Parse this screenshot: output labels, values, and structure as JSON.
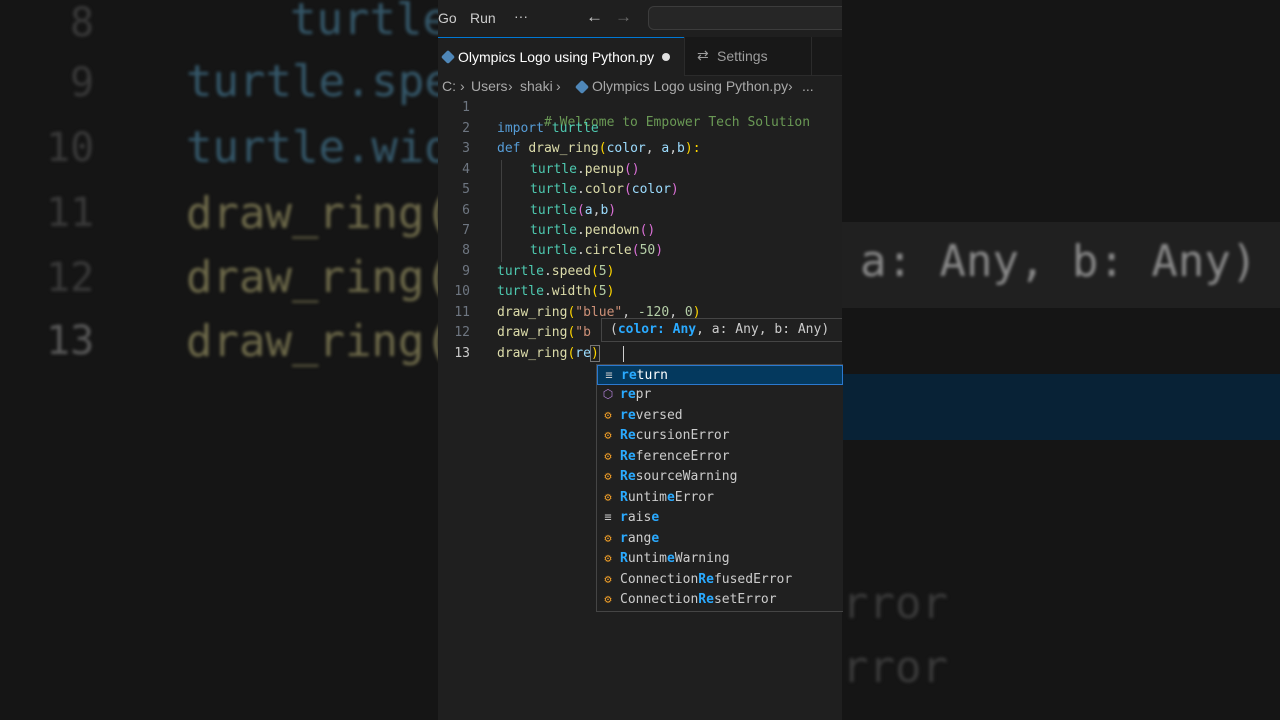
{
  "menu": {
    "go": "Go",
    "run": "Run",
    "more": "···",
    "back": "←",
    "forward": "→"
  },
  "tabs": {
    "active": "Olympics Logo using Python.py",
    "settings": "Settings",
    "settings_icon": "⇄"
  },
  "breadcrumb": {
    "drive": "C:",
    "sep": "›",
    "users": "Users",
    "user": "shaki",
    "file": "Olympics Logo using Python.py",
    "more": "..."
  },
  "line_numbers": [
    "1",
    "2",
    "3",
    "4",
    "5",
    "6",
    "7",
    "8",
    "9",
    "10",
    "11",
    "12",
    "13"
  ],
  "code": {
    "l1": "# Welcome to Empower Tech Solution",
    "l2a": "import",
    "l2b": "turtle",
    "l3a": "def",
    "l3b": "draw_ring",
    "l3c": "(",
    "l3d": "color",
    "l3e": ", ",
    "l3f": "a",
    "l3g": ",",
    "l3h": "b",
    "l3i": "):",
    "l4a": "turtle",
    "l4b": ".",
    "l4c": "penup",
    "l4d": "()",
    "l5a": "turtle",
    "l5b": ".",
    "l5c": "color",
    "l5d": "(",
    "l5e": "color",
    "l5f": ")",
    "l6a": "turtle",
    "l6b": "(",
    "l6c": "a",
    "l6d": ",",
    "l6e": "b",
    "l6f": ")",
    "l7a": "turtle",
    "l7b": ".",
    "l7c": "pendown",
    "l7d": "()",
    "l8a": "turtle",
    "l8b": ".",
    "l8c": "circle",
    "l8d": "(",
    "l8e": "50",
    "l8f": ")",
    "l9a": "turtle",
    "l9b": ".",
    "l9c": "speed",
    "l9d": "(",
    "l9e": "5",
    "l9f": ")",
    "l10a": "turtle",
    "l10b": ".",
    "l10c": "width",
    "l10d": "(",
    "l10e": "5",
    "l10f": ")",
    "l11a": "draw_ring",
    "l11b": "(",
    "l11c": "\"blue\"",
    "l11d": ", ",
    "l11e": "-120",
    "l11f": ", ",
    "l11g": "0",
    "l11h": ")",
    "l12a": "draw_ring",
    "l12b": "(",
    "l12c": "\"b",
    "l13a": "draw_ring",
    "l13b": "(",
    "l13c": "re",
    "l13d": ")"
  },
  "signature": {
    "open": "(",
    "active_param": "color: Any",
    "rest": ", a: Any, b: Any)"
  },
  "suggestions": [
    {
      "kind": "keyword-icon",
      "match": "re",
      "rest": "turn",
      "glyph": "≡"
    },
    {
      "kind": "cube-icon",
      "match": "re",
      "rest": "pr",
      "glyph": "⬡"
    },
    {
      "kind": "class-icon",
      "match": "re",
      "rest": "versed",
      "glyph": "⚙"
    },
    {
      "kind": "class-icon",
      "match": "Re",
      "rest": "cursionError",
      "glyph": "⚙"
    },
    {
      "kind": "class-icon",
      "match": "Re",
      "rest": "ferenceError",
      "glyph": "⚙"
    },
    {
      "kind": "class-icon",
      "match": "Re",
      "rest": "sourceWarning",
      "glyph": "⚙"
    },
    {
      "kind": "class-icon",
      "pre": "",
      "match": "R",
      "mid": "untim",
      "match2": "e",
      "rest": "Error",
      "glyph": "⚙"
    },
    {
      "kind": "keyword-icon",
      "pre": "",
      "match": "r",
      "mid": "ais",
      "match2": "e",
      "rest": "",
      "glyph": "≡"
    },
    {
      "kind": "class-icon",
      "pre": "",
      "match": "r",
      "mid": "ang",
      "match2": "e",
      "rest": "",
      "glyph": "⚙"
    },
    {
      "kind": "class-icon",
      "pre": "",
      "match": "R",
      "mid": "untim",
      "match2": "e",
      "rest": "Warning",
      "glyph": "⚙"
    },
    {
      "kind": "class-icon",
      "pre": "Connection",
      "match": "Re",
      "rest": "fusedError",
      "glyph": "⚙"
    },
    {
      "kind": "class-icon",
      "pre": "Connection",
      "match": "Re",
      "rest": "setError",
      "glyph": "⚙"
    }
  ],
  "background": {
    "left_numbers": [
      "8",
      "9",
      "10",
      "11",
      "12",
      "13"
    ],
    "left_lines": [
      "turtle",
      "turtle.spe",
      "turtle.wid",
      "draw_ring(",
      "draw_ring(",
      "draw_ring("
    ],
    "right_sig": "a: Any, b: Any)",
    "right_err1": "rror",
    "right_err2": "rror"
  },
  "colors": {
    "accent": "#0078d4",
    "selection": "#04395e",
    "keyword": "#569cd6",
    "function": "#dcdcaa",
    "class": "#4ec9b0"
  }
}
